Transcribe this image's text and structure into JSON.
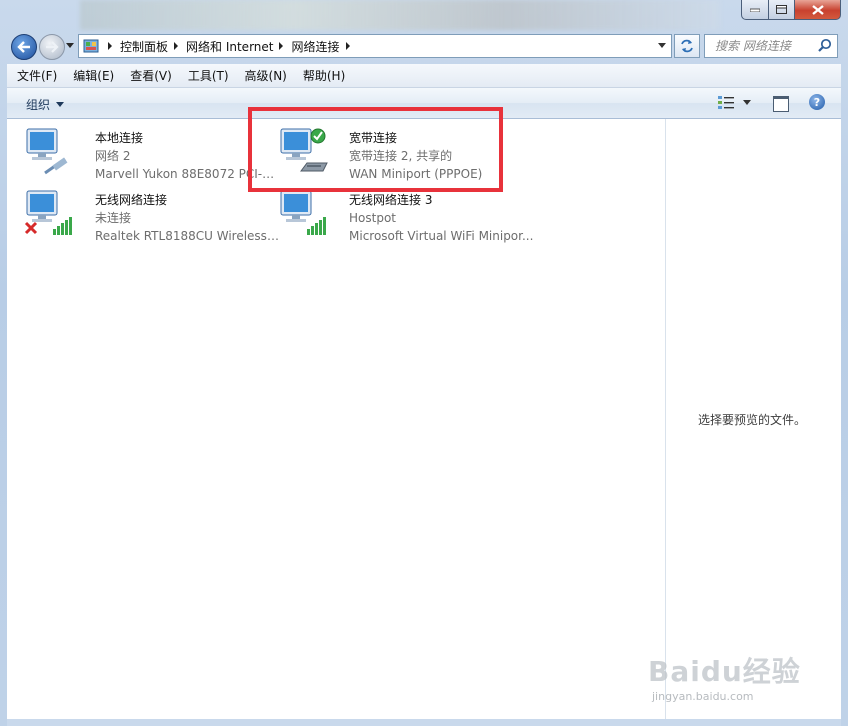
{
  "window": {
    "title_buttons": [
      "minimize",
      "maximize",
      "close"
    ]
  },
  "address_bar": {
    "crumbs": [
      "控制面板",
      "网络和 Internet",
      "网络连接"
    ]
  },
  "search": {
    "placeholder": "搜索 网络连接"
  },
  "menubar": {
    "items": [
      "文件(F)",
      "编辑(E)",
      "查看(V)",
      "工具(T)",
      "高级(N)",
      "帮助(H)"
    ]
  },
  "toolbar": {
    "organize_label": "组织"
  },
  "connections": [
    {
      "name": "本地连接",
      "status": "网络  2",
      "device": "Marvell Yukon 88E8072 PCI-E...",
      "icon": "wired-network-icon"
    },
    {
      "name": "宽带连接",
      "status": "宽带连接  2, 共享的",
      "device": "WAN Miniport (PPPOE)",
      "icon": "broadband-connected-icon"
    },
    {
      "name": "无线网络连接",
      "status": "未连接",
      "device": "Realtek RTL8188CU Wireless L...",
      "icon": "wireless-disconnected-icon"
    },
    {
      "name": "无线网络连接 3",
      "status": "Hostpot",
      "device": "Microsoft Virtual WiFi Minipor...",
      "icon": "wireless-network-icon"
    }
  ],
  "preview_pane": {
    "message": "选择要预览的文件。"
  },
  "watermark": {
    "brand": "Baidu经验",
    "url": "jingyan.baidu.com"
  },
  "colors": {
    "highlight": "#e8323b",
    "accent": "#1f5aa8"
  }
}
